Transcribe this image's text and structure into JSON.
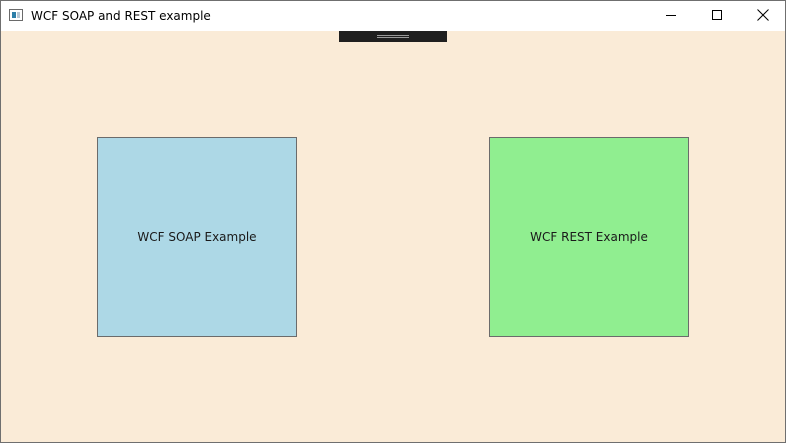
{
  "window": {
    "title": "WCF SOAP and REST example",
    "background_color": "#FAEBD7"
  },
  "title_bar": {
    "app_icon": "app-window-icon",
    "minimize_icon": "minimize-icon",
    "maximize_icon": "maximize-icon",
    "close_icon": "close-icon"
  },
  "buttons": [
    {
      "label": "WCF SOAP Example",
      "color": "#ADD8E6"
    },
    {
      "label": "WCF REST Example",
      "color": "#90EE90"
    }
  ]
}
